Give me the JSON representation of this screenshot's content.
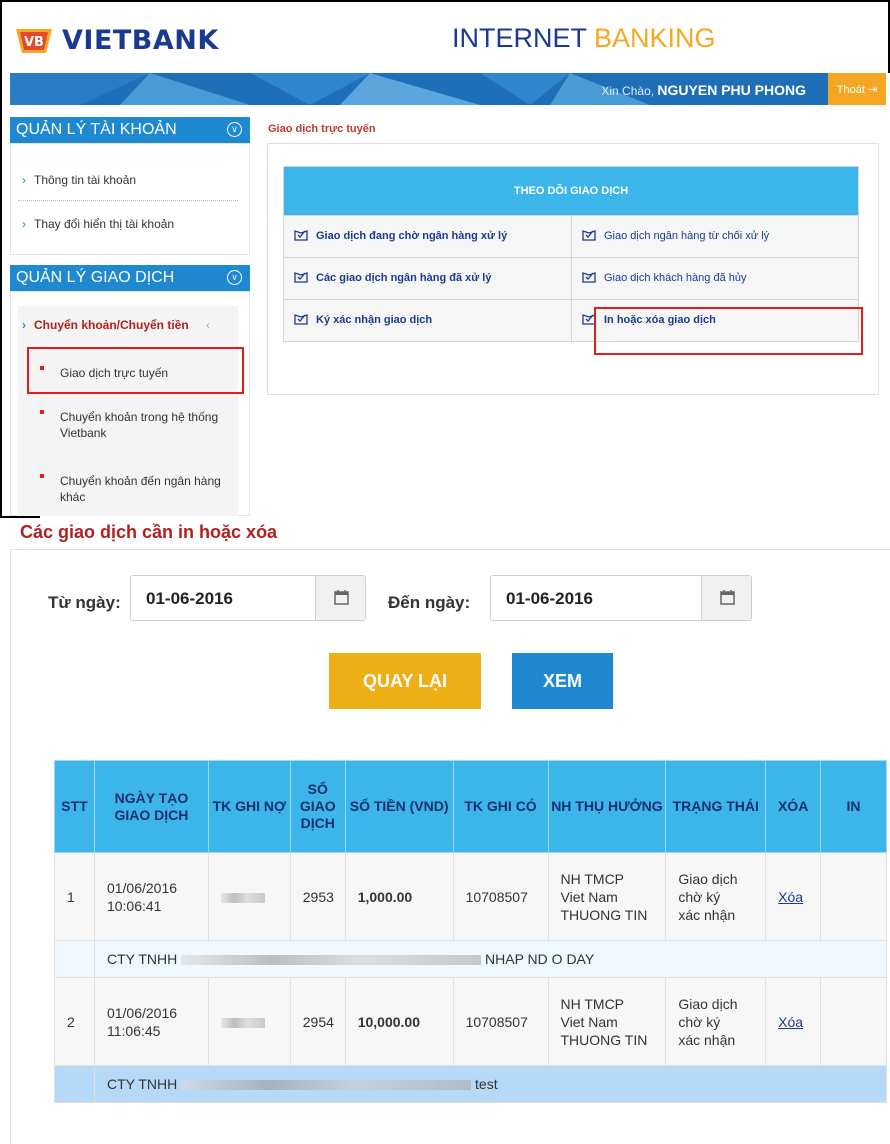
{
  "header": {
    "logo_text": "VB",
    "brand": "VIETBANK",
    "title_main": "INTERNET",
    "title_accent": "BANKING",
    "greeting_prefix": "Xin Chào,",
    "user_name": "NGUYEN PHU PHONG",
    "logout_label": "Thoát"
  },
  "sidebar": {
    "account_section": "QUẢN LÝ TÀI KHOẢN",
    "account_items": [
      "Thông tin tài khoản",
      "Thay đổi hiển thị tài khoản"
    ],
    "transaction_section": "QUẢN LÝ GIAO DỊCH",
    "transfer_group": "Chuyển khoản/Chuyển tiền",
    "transfer_items": [
      "Giao dịch trực tuyến",
      "Chuyển khoản trong hệ thống Vietbank",
      "Chuyển khoản đến ngân hàng khác"
    ]
  },
  "online": {
    "breadcrumb": "Giao dịch trực tuyến",
    "grid_title": "THEO DÕI GIAO DỊCH",
    "grid_items": [
      "Giao dịch đang chờ ngân hàng xử lý",
      "Giao dịch ngân hàng từ chối xử lý",
      "Các giao dịch ngân hàng đã xử lý",
      "Giao dịch khách hàng đã hủy",
      "Ký xác nhận giao dịch",
      "In hoặc xóa giao dịch"
    ]
  },
  "print_delete": {
    "title": "Các giao dịch cần in hoặc xóa",
    "from_label": "Từ ngày:",
    "from_value": "01-06-2016",
    "to_label": "Đến ngày:",
    "to_value": "01-06-2016",
    "back_label": "QUAY LẠI",
    "view_label": "XEM"
  },
  "table": {
    "headers": [
      "STT",
      "NGÀY TẠO GIAO DỊCH",
      "TK GHI NỢ",
      "SỐ GIAO DỊCH",
      "SỐ TIỀN (VND)",
      "TK GHI CÓ",
      "NH THỤ HƯỞNG",
      "TRẠNG THÁI",
      "XÓA",
      "IN"
    ],
    "rows": [
      {
        "stt": "1",
        "date": "01/06/2016",
        "time": "10:06:41",
        "number": "2953",
        "amount": "1,000.00",
        "credit": "10708507",
        "bank_1": "NH TMCP",
        "bank_2": "Viet Nam",
        "bank_3": "THUONG TIN",
        "status_1": "Giao dịch",
        "status_2": "chờ ký",
        "status_3": "xác nhận",
        "delete": "Xóa",
        "note_prefix": "CTY TNHH",
        "note_suffix": "NHAP ND O DAY"
      },
      {
        "stt": "2",
        "date": "01/06/2016",
        "time": "11:06:45",
        "number": "2954",
        "amount": "10,000.00",
        "credit": "10708507",
        "bank_1": "NH TMCP",
        "bank_2": "Viet Nam",
        "bank_3": "THUONG TIN",
        "status_1": "Giao dịch",
        "status_2": "chờ ký",
        "status_3": "xác nhận",
        "delete": "Xóa",
        "note_prefix": "CTY TNHH",
        "note_suffix": "test"
      }
    ]
  },
  "colors": {
    "brand_blue": "#1a3a8f",
    "accent_orange": "#f7a823",
    "sky_blue": "#3cb5ea",
    "alert_red": "#e41b1b"
  }
}
